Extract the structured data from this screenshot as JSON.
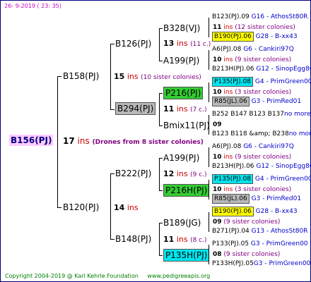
{
  "header": {
    "date": "26-  9-2019 (  23: 35)"
  },
  "root": {
    "name": "B156(PJ)",
    "count": "17",
    "ins": "ins",
    "note": "(Drones from 8 sister colonies)"
  },
  "gen1": [
    {
      "name": "B158(PJ)",
      "count": "15",
      "ins": "ins",
      "note": "(10 sister colonies)"
    },
    {
      "name": "B120(PJ)",
      "count": "14",
      "ins": "ins",
      "note": ""
    }
  ],
  "gen2": [
    {
      "name": "B126(PJ)",
      "count": "13",
      "ins": "ins",
      "note": "(11 c.)"
    },
    {
      "name": "B294(PJ)",
      "count": "11",
      "ins": "ins",
      "note": "(7 c.)"
    },
    {
      "name": "B222(PJ)",
      "count": "12",
      "ins": "ins",
      "note": "(9 c.)"
    },
    {
      "name": "B148(PJ)",
      "count": "11",
      "ins": "ins",
      "note": "(8 c.)"
    }
  ],
  "gen3": [
    {
      "name": "B328(VJ)",
      "count": "11",
      "ins": "ins",
      "note": "(12 sister colonies)"
    },
    {
      "name": "A199(PJ)",
      "count": "10",
      "ins": "ins",
      "note": "(9 sister colonies)"
    },
    {
      "name": "P216(PJ)",
      "count": "10",
      "ins": "ins",
      "note": "(3 sister colonies)"
    },
    {
      "name": "Bmix11(PJ)",
      "count": "09",
      "ins": "",
      "note": ""
    },
    {
      "name": "A199(PJ)",
      "count": "10",
      "ins": "ins",
      "note": "(9 sister colonies)"
    },
    {
      "name": "P216H(PJ)",
      "count": "10",
      "ins": "ins",
      "note": "(3 sister colonies)"
    },
    {
      "name": "B189(JG)",
      "count": "09",
      "ins": "",
      "note": "(9 sister colonies)"
    },
    {
      "name": "P135H(PJ)",
      "count": "08",
      "ins": "",
      "note": "(9 sister colonies)"
    }
  ],
  "gen4": [
    {
      "name": "B123(PJ).09",
      "info": "G16 - AthosSt80R"
    },
    {
      "name": "B190(PJ).06",
      "info": "G28 - B-xx43"
    },
    {
      "name": "A6(PJ).08",
      "info": "G6 - Cankiri97Q"
    },
    {
      "name": "B213H(PJ).06",
      "info": "G12 - SinopEgg86R"
    },
    {
      "name": "P135(PJ).08",
      "info": "G4 - PrimGreen00"
    },
    {
      "name": "R85(JL).06",
      "info": "G3 - PrimRed01"
    },
    {
      "name": "B252 B147 B123 B137",
      "info": "no more"
    },
    {
      "name": "B123 B118 &amp; B238",
      "info": "no more"
    },
    {
      "name": "A6(PJ).08",
      "info": "G6 - Cankiri97Q"
    },
    {
      "name": "B213H(PJ).06",
      "info": "G12 - SinopEgg86R"
    },
    {
      "name": "P135(PJ).08",
      "info": "G4 - PrimGreen00"
    },
    {
      "name": "R85(JL).06",
      "info": "G3 - PrimRed01"
    },
    {
      "name": "B190(PJ).06",
      "info": "G28 - B-xx43"
    },
    {
      "name": "B271(PJ).04",
      "info": "G13 - AthosSt80R"
    },
    {
      "name": "P133(PJ).05",
      "info": "G3 - PrimGreen00"
    },
    {
      "name": "P133H(PJ).05",
      "info": "G3 - PrimGreen00"
    }
  ],
  "footer": {
    "copyright": "Copyright 2004-2019 @ Karl Kehrle Foundation",
    "url": "www.pedigreeapis.org"
  }
}
